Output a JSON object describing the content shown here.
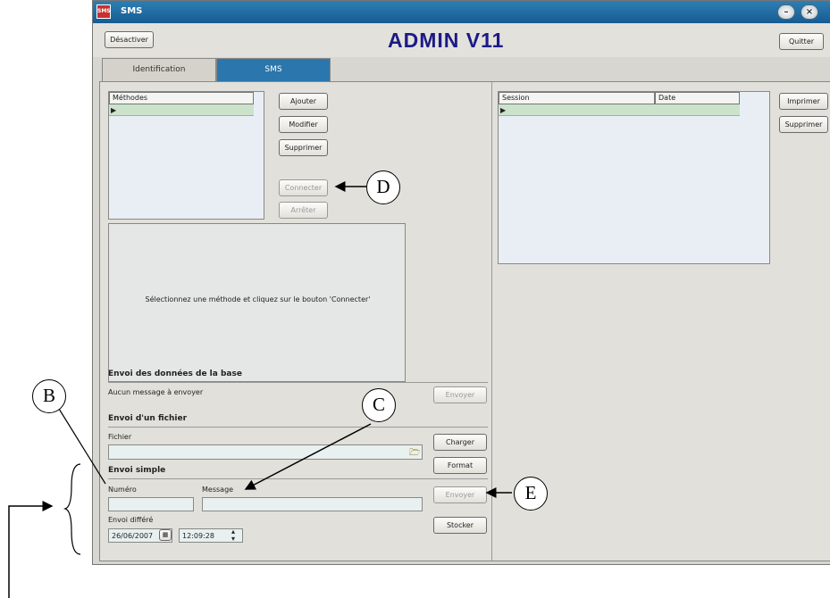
{
  "window": {
    "title": "SMS",
    "icon": "app-sms-icon",
    "app_title": "ADMIN V11",
    "deactivate_label": "Désactiver",
    "quit_label": "Quitter",
    "minimize_icon": "minimize-icon",
    "close_icon": "close-icon",
    "tabs": [
      {
        "label": "Identification",
        "active": false
      },
      {
        "label": "SMS",
        "active": true
      }
    ]
  },
  "methods": {
    "column": "Méthodes",
    "add": "Ajouter",
    "modify": "Modifier",
    "delete": "Supprimer",
    "connect": "Connecter",
    "stop": "Arrêter"
  },
  "info_text": "Sélectionnez une méthode et cliquez sur le bouton 'Connecter'",
  "sessions": {
    "col_session": "Session",
    "col_date": "Date",
    "print": "Imprimer",
    "delete": "Supprimer"
  },
  "db_send": {
    "title": "Envoi des données de la base",
    "status": "Aucun message à envoyer",
    "send": "Envoyer"
  },
  "file_send": {
    "title": "Envoi d'un fichier",
    "file_label": "Fichier",
    "file_value": "",
    "load": "Charger",
    "format": "Format",
    "folder_icon": "folder-open-icon"
  },
  "simple_send": {
    "title": "Envoi simple",
    "number_label": "Numéro",
    "message_label": "Message",
    "number_value": "",
    "message_value": "",
    "send": "Envoyer",
    "deferred_label": "Envoi différé",
    "date": "26/06/2007",
    "time": "12:09:28",
    "store": "Stocker",
    "calendar_icon": "calendar-icon",
    "spinner_icon": "spinner-icon"
  },
  "annotations": {
    "B": "B",
    "C": "C",
    "D": "D",
    "E": "E"
  },
  "colors": {
    "titlebar": "#2b77ad",
    "app_title": "#1c1a86",
    "grid_row": "#cbe3cb",
    "list_bg": "#e9eef4"
  }
}
